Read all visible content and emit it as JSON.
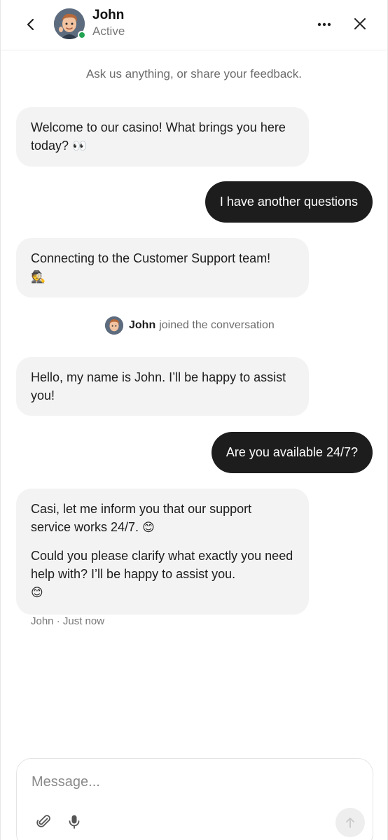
{
  "header": {
    "agent_name": "John",
    "agent_status": "Active",
    "status_color": "#22a352",
    "icons": {
      "back": "chevron-left-icon",
      "more": "more-horizontal-icon",
      "close": "close-icon"
    }
  },
  "chat": {
    "intro": "Ask us anything, or share your feedback.",
    "messages": [
      {
        "from": "agent",
        "text": "Welcome to our casino! What brings you here today?",
        "emoji": "👀"
      },
      {
        "from": "user",
        "text": "I have another questions"
      },
      {
        "from": "agent",
        "text": "Connecting to the Customer Support team!",
        "emoji": "🕵"
      },
      {
        "from": "user",
        "text": "Are you available 24/7?"
      }
    ],
    "joined": {
      "name": "John",
      "suffix": "joined the conversation"
    },
    "hello": {
      "text": "Hello, my name is John. I’ll be happy to assist you!"
    },
    "last_agent": {
      "para1": "Casi, let me inform you that our support service works 24/7.",
      "para1_emoji": "😊",
      "para2": "Could you please clarify what exactly you need help with? I’ll be happy to assist you.",
      "para2_emoji": "😊"
    },
    "meta": {
      "name": "John",
      "separator": "·",
      "time": "Just now"
    }
  },
  "composer": {
    "placeholder": "Message...",
    "icons": {
      "attach": "paperclip-icon",
      "mic": "microphone-icon",
      "send": "send-arrow-icon"
    }
  },
  "colors": {
    "user_bubble": "#1d1d1d",
    "agent_bubble": "#f3f3f3"
  }
}
